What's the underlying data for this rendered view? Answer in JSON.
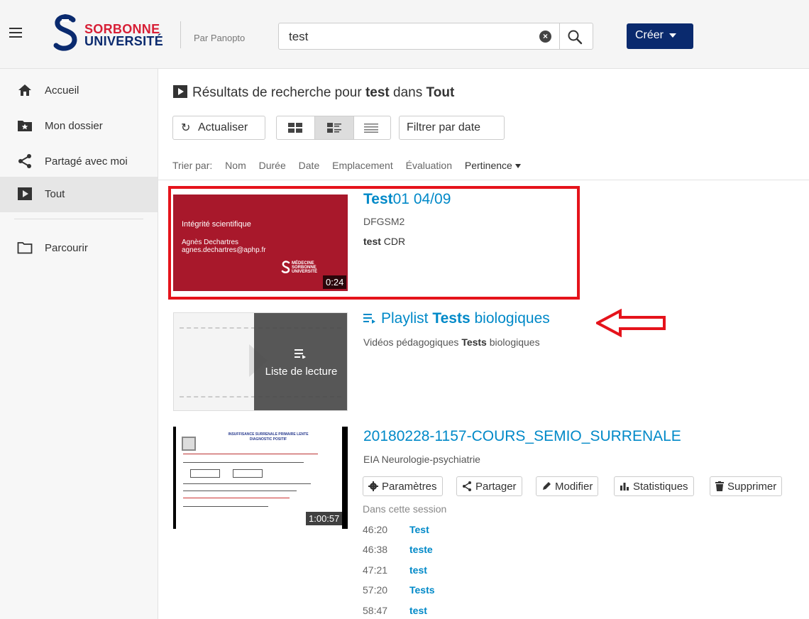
{
  "header": {
    "logo_line1": "SORBONNE",
    "logo_line2": "UNIVERSITÉ",
    "by_label": "Par Panopto",
    "search_value": "test",
    "create_label": "Créer"
  },
  "sidebar": {
    "items": [
      {
        "label": "Accueil",
        "icon": "home-icon"
      },
      {
        "label": "Mon dossier",
        "icon": "star-folder-icon"
      },
      {
        "label": "Partagé avec moi",
        "icon": "share-icon"
      },
      {
        "label": "Tout",
        "icon": "play-box-icon",
        "active": true
      },
      {
        "label": "Parcourir",
        "icon": "folder-icon"
      }
    ]
  },
  "results": {
    "prefix": "Résultats de recherche pour ",
    "term": "test",
    "mid": " dans ",
    "scope": "Tout"
  },
  "toolbar": {
    "refresh_label": "Actualiser",
    "filter_label": "Filtrer par date"
  },
  "sort": {
    "label": "Trier par:",
    "options": [
      "Nom",
      "Durée",
      "Date",
      "Emplacement",
      "Évaluation",
      "Pertinence"
    ]
  },
  "items": [
    {
      "title_bold": "Test",
      "title_rest": "01 04/09",
      "folder": "DFGSM2",
      "snippet_bold": "test",
      "snippet_rest": " CDR",
      "thumb_title": "Intégrité scientifique",
      "thumb_author": "Agnès Dechartres",
      "thumb_email": "agnes.dechartres@aphp.fr",
      "thumb_logo": [
        "MÉDECINE",
        "SORBONNE",
        "UNIVERSITÉ"
      ],
      "duration": "0:24"
    },
    {
      "title_pre": "Playlist ",
      "title_bold": "Tests",
      "title_post": " biologiques",
      "desc_pre": "Vidéos pédagogiques ",
      "desc_bold": "Tests",
      "desc_post": " biologiques",
      "overlay_label": "Liste de lecture"
    },
    {
      "title": "20180228-1157-COURS_SEMIO_SURRENALE",
      "folder": "EIA Neurologie-psychiatrie",
      "duration": "1:00:57",
      "slide_title": "INSUFFISANCE SURRENALE PRIMAIRE LENTE",
      "slide_subtitle": "DIAGNOSTIC POSITIF",
      "actions": [
        "Paramètres",
        "Partager",
        "Modifier",
        "Statistiques",
        "Supprimer"
      ],
      "session_label": "Dans cette session",
      "session_hits": [
        {
          "time": "46:20",
          "word": "Test"
        },
        {
          "time": "46:38",
          "word": "teste"
        },
        {
          "time": "47:21",
          "word": "test"
        },
        {
          "time": "57:20",
          "word": "Tests"
        },
        {
          "time": "58:47",
          "word": "test"
        }
      ]
    }
  ],
  "colors": {
    "brand_red": "#d71f36",
    "brand_navy": "#0a2a6e",
    "link_blue": "#0089c8",
    "highlight_red": "#e5131b"
  }
}
